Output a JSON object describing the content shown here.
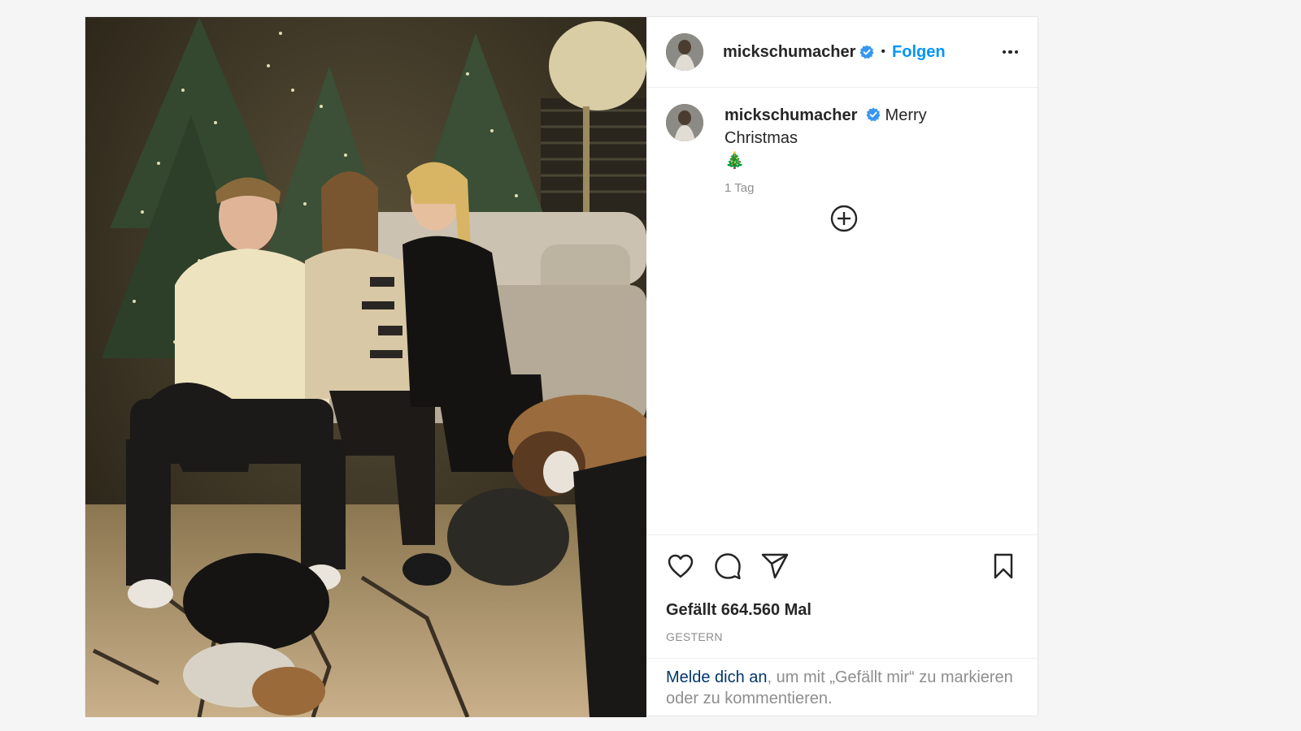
{
  "post": {
    "username": "mickschumacher",
    "separator": "•",
    "follow_label": "Folgen",
    "caption_text": "Merry Christmas",
    "caption_emoji": "🎄",
    "caption_time": "1 Tag",
    "likes_text": "Gefällt 664.560 Mal",
    "date_text": "GESTERN",
    "login_link": "Melde dich an",
    "login_text": ", um mit „Gefällt mir“ zu markieren oder zu kommentieren."
  },
  "icons": {
    "verified": "verified-badge-icon",
    "more": "more-options-icon",
    "load_more": "load-more-comments-icon",
    "like": "heart-icon",
    "comment": "comment-bubble-icon",
    "share": "paper-plane-icon",
    "save": "bookmark-icon"
  },
  "colors": {
    "accent": "#0095f6",
    "link": "#00376b",
    "muted": "#8e8e8e",
    "verified": "#3897f0"
  }
}
